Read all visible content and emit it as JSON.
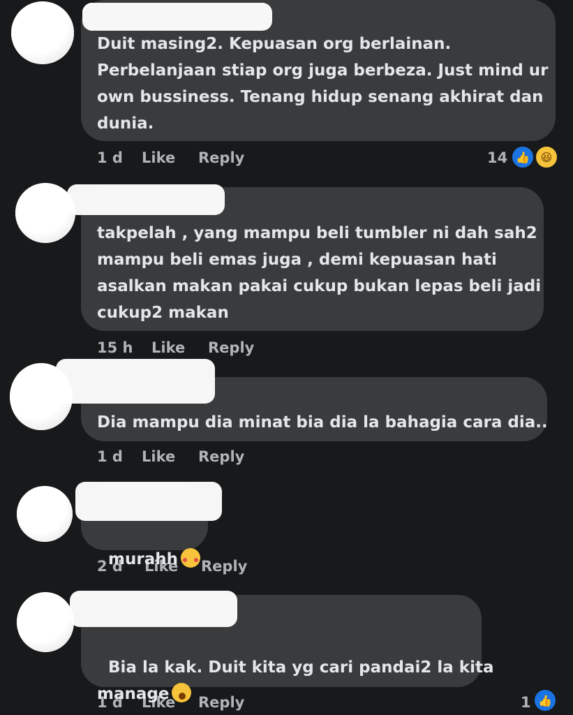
{
  "comments": [
    {
      "text": "Duit masing2. Kepuasan org berlainan.\nPerbelanjaan stiap org juga berbeza. Just mind ur\nown bussiness. Tenang hidup senang akhirat dan\ndunia.",
      "time": "1 d",
      "like_label": "Like",
      "reply_label": "Reply",
      "reaction_count": "14",
      "reactions": [
        "like-icon",
        "haha-icon"
      ]
    },
    {
      "text": "takpelah , yang mampu beli tumbler ni dah sah2\nmampu beli emas juga , demi kepuasan hati\nasalkan makan pakai cukup bukan lepas beli jadi\ncukup2 makan",
      "time": "15 h",
      "like_label": "Like",
      "reply_label": "Reply"
    },
    {
      "text": "Dia mampu dia minat bia dia la bahagia cara dia..",
      "time": "1 d",
      "like_label": "Like",
      "reply_label": "Reply"
    },
    {
      "text": "murahh",
      "emoji": "smiling-face-with-hearts",
      "time": "2 d",
      "like_label": "Like",
      "reply_label": "Reply"
    },
    {
      "text": "Bia la kak. Duit kita yg cari pandai2 la kita\nmanage",
      "emoji": "yawning-face",
      "time": "1 d",
      "like_label": "Like",
      "reply_label": "Reply",
      "reaction_count": "1",
      "reactions": [
        "like-icon"
      ]
    }
  ],
  "colors": {
    "background": "#18191a",
    "bubble": "#3a3b3c",
    "text": "#e4e6eb",
    "meta": "#b0b3b8",
    "like_blue": "#1b74e4",
    "haha_yellow": "#f7c33b"
  }
}
